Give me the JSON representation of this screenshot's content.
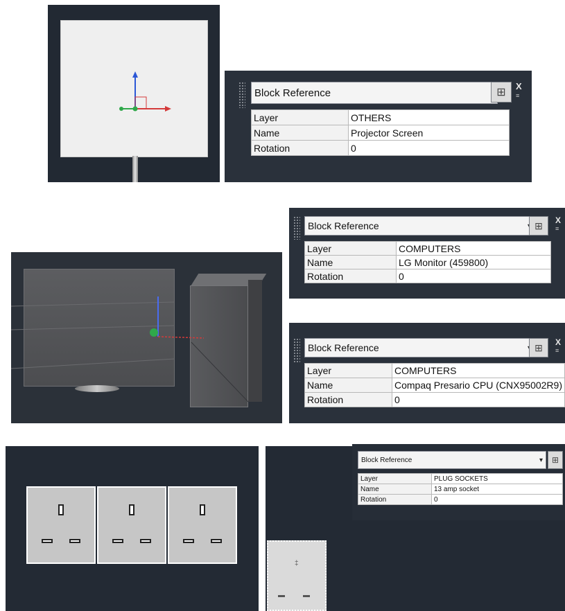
{
  "widgets": [
    {
      "title": "Block Reference",
      "rows": [
        {
          "key": "Layer",
          "value": "OTHERS"
        },
        {
          "key": "Name",
          "value": "Projector Screen"
        },
        {
          "key": "Rotation",
          "value": "0"
        }
      ]
    },
    {
      "title": "Block Reference",
      "rows": [
        {
          "key": "Layer",
          "value": "COMPUTERS"
        },
        {
          "key": "Name",
          "value": "LG Monitor (459800)"
        },
        {
          "key": "Rotation",
          "value": "0"
        }
      ]
    },
    {
      "title": "Block Reference",
      "rows": [
        {
          "key": "Layer",
          "value": "COMPUTERS"
        },
        {
          "key": "Name",
          "value": "Compaq Presario CPU (CNX95002R9)"
        },
        {
          "key": "Rotation",
          "value": "0"
        }
      ]
    },
    {
      "title": "Block Reference",
      "rows": [
        {
          "key": "Layer",
          "value": "PLUG SOCKETS"
        },
        {
          "key": "Name",
          "value": "13 amp socket"
        },
        {
          "key": "Rotation",
          "value": "0"
        }
      ]
    }
  ],
  "icons": {
    "dropdown": "chevron-down-icon",
    "quick_select": "quick-select-icon",
    "close": "close-icon",
    "menu": "menu-icon"
  },
  "close_glyph": "X",
  "dropdown_glyph": "▾",
  "colors": {
    "canvas_bg": "#222933",
    "gizmo_x": "#d43a3a",
    "gizmo_y": "#2b57d6",
    "gizmo_z": "#2fa84a"
  }
}
